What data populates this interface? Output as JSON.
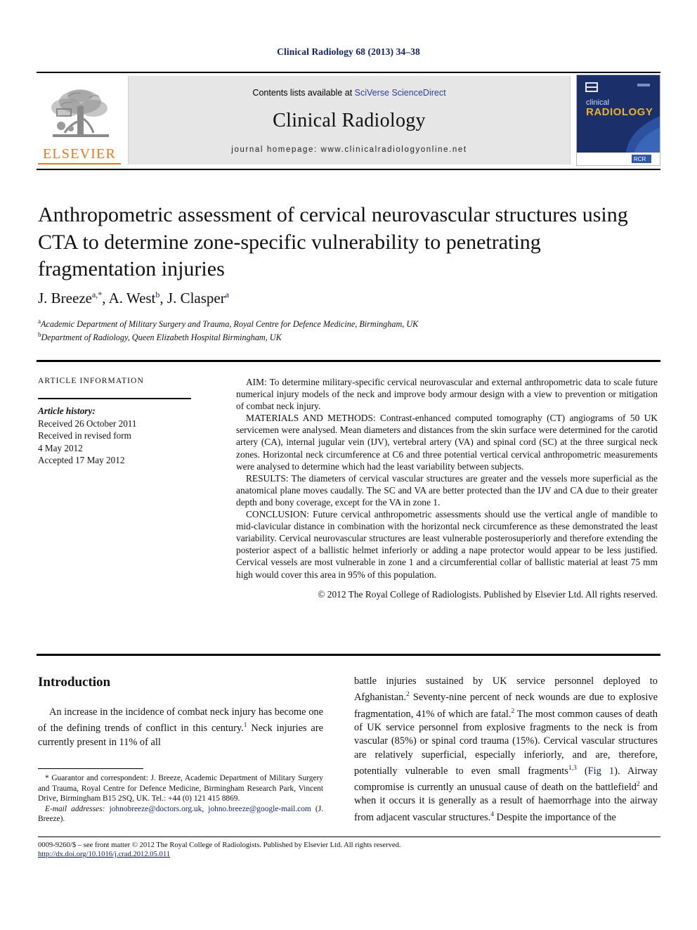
{
  "running_head": "Clinical Radiology 68 (2013) 34–38",
  "masthead": {
    "publisher_name": "ELSEVIER",
    "contents_prefix": "Contents lists available at ",
    "contents_link": "SciVerse ScienceDirect",
    "journal_name": "Clinical Radiology",
    "homepage": "journal homepage: www.clinicalradiologyonline.net",
    "cover": {
      "line1": "clinical",
      "line2": "RADIOLOGY",
      "badge": "RCR"
    }
  },
  "article": {
    "title": "Anthropometric assessment of cervical neurovascular structures using CTA to determine zone-specific vulnerability to penetrating fragmentation injuries",
    "authors": [
      {
        "name": "J. Breeze",
        "marks": "a,*"
      },
      {
        "name": "A. West",
        "marks": "b"
      },
      {
        "name": "J. Clasper",
        "marks": "a"
      }
    ],
    "affiliations": [
      {
        "mark": "a",
        "text": "Academic Department of Military Surgery and Trauma, Royal Centre for Defence Medicine, Birmingham, UK"
      },
      {
        "mark": "b",
        "text": "Department of Radiology, Queen Elizabeth Hospital Birmingham, UK"
      }
    ]
  },
  "article_information": {
    "heading": "ARTICLE INFORMATION",
    "history_label": "Article history:",
    "history": [
      "Received 26 October 2011",
      "Received in revised form",
      "4 May 2012",
      "Accepted 17 May 2012"
    ]
  },
  "abstract": {
    "aim": "AIM: To determine military-specific cervical neurovascular and external anthropometric data to scale future numerical injury models of the neck and improve body armour design with a view to prevention or mitigation of combat neck injury.",
    "materials": "MATERIALS AND METHODS: Contrast-enhanced computed tomography (CT) angiograms of 50 UK servicemen were analysed. Mean diameters and distances from the skin surface were determined for the carotid artery (CA), internal jugular vein (IJV), vertebral artery (VA) and spinal cord (SC) at the three surgical neck zones. Horizontal neck circumference at C6 and three potential vertical cervical anthropometric measurements were analysed to determine which had the least variability between subjects.",
    "results": "RESULTS: The diameters of cervical vascular structures are greater and the vessels more superficial as the anatomical plane moves caudally. The SC and VA are better protected than the IJV and CA due to their greater depth and bony coverage, except for the VA in zone 1.",
    "conclusion": "CONCLUSION: Future cervical anthropometric assessments should use the vertical angle of mandible to mid-clavicular distance in combination with the horizontal neck circumference as these demonstrated the least variability. Cervical neurovascular structures are least vulnerable posterosuperiorly and therefore extending the posterior aspect of a ballistic helmet inferiorly or adding a nape protector would appear to be less justified. Cervical vessels are most vulnerable in zone 1 and a circumferential collar of ballistic material at least 75 mm high would cover this area in 95% of this population.",
    "copyright": "© 2012 The Royal College of Radiologists. Published by Elsevier Ltd. All rights reserved."
  },
  "body": {
    "intro_heading": "Introduction",
    "left_paragraph_1": "An increase in the incidence of combat neck injury has become one of the defining trends of conflict in this century.",
    "left_ref_1": "1",
    "left_paragraph_1b": " Neck injuries are currently present in 11% of all",
    "right_paragraph_a": "battle injuries sustained by UK service personnel deployed to Afghanistan.",
    "right_ref_1": "2",
    "right_paragraph_b": " Seventy-nine percent of neck wounds are due to explosive fragmentation, 41% of which are fatal.",
    "right_ref_2": "2",
    "right_paragraph_c": " The most common causes of death of UK service personnel from explosive fragments to the neck is from vascular (85%) or spinal cord trauma (15%). Cervical vascular structures are relatively superficial, especially inferiorly, and are, therefore, potentially vulnerable to even small fragments",
    "right_ref_3": "1,3",
    "right_fig_open": " (",
    "right_fig_link": "Fig 1",
    "right_paragraph_d": "). Airway compromise is currently an unusual cause of death on the battlefield",
    "right_ref_4": "2",
    "right_paragraph_e": " and when it occurs it is generally as a result of haemorrhage into the airway from adjacent vascular structures.",
    "right_ref_5": "4",
    "right_paragraph_f": " Despite the importance of the"
  },
  "footnote": {
    "correspondence": "* Guarantor and correspondent: J. Breeze, Academic Department of Military Surgery and Trauma, Royal Centre for Defence Medicine, Birmingham Research Park, Vincent Drive, Birmingham B15 2SQ, UK. Tel.: +44 (0) 121 415 8869.",
    "email_label": "E-mail addresses:",
    "email_1": "johnobreeze@doctors.org.uk",
    "email_sep": ", ",
    "email_2": "johno.breeze@google-mail.com",
    "email_owner": " (J. Breeze)."
  },
  "bottom": {
    "frontmatter": "0009-9260/$ – see front matter © 2012 The Royal College of Radiologists. Published by Elsevier Ltd. All rights reserved.",
    "doi": "http://dx.doi.org/10.1016/j.crad.2012.05.011"
  },
  "colors": {
    "link_blue": "#11215e",
    "sciencedirect_blue": "#2b3f9e",
    "elsevier_orange": "#e87722",
    "band_grey": "#e6e6e6",
    "cover_navy": "#1b2f6b"
  }
}
